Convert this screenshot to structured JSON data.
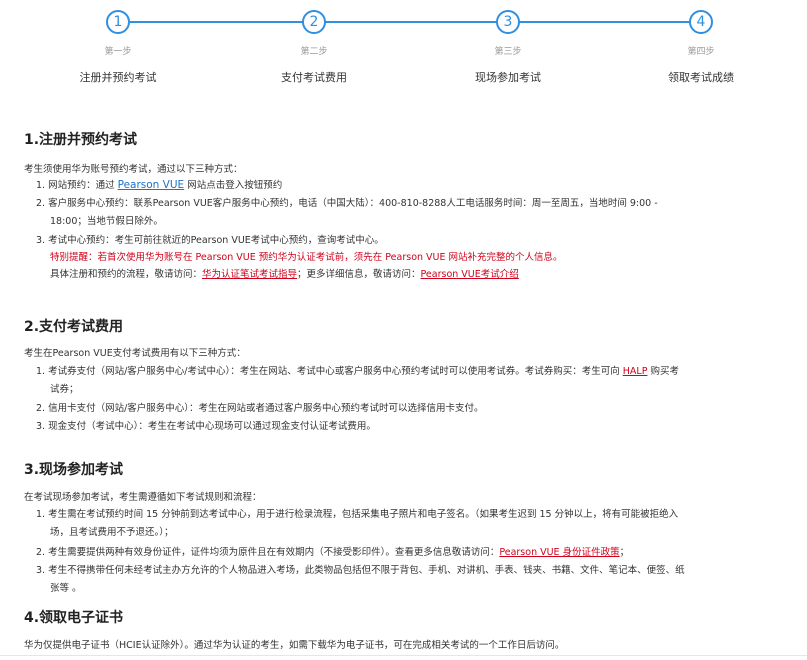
{
  "stepper": {
    "steps": [
      {
        "number": "1",
        "title": "第一步",
        "label": "注册并预约考试"
      },
      {
        "number": "2",
        "title": "第二步",
        "label": "支付考试费用"
      },
      {
        "number": "3",
        "title": "第三步",
        "label": "现场参加考试"
      },
      {
        "number": "4",
        "title": "第四步",
        "label": "领取考试成绩"
      }
    ]
  },
  "section1": {
    "title": "1.注册并预约考试",
    "intro": "考生须使用华为账号预约考试，通过以下三种方式：",
    "item1_prefix": "1. 网站预约：通过 ",
    "item1_link": "Pearson VUE",
    "item1_suffix": " 网站点击登入按钮预约",
    "item2_line1": "2. 客户服务中心预约：联系Pearson VUE客户服务中心预约，电话（中国大陆）：400-810-8288人工电话服务时间：周一至周五，当地时间 9:00 -",
    "item2_line2": "18:00；当地节假日除外。",
    "item3": "3. 考试中心预约：考生可前往就近的Pearson VUE考试中心预约，查询考试中心。",
    "notice": "特别提醒：若首次使用华为账号在 Pearson VUE 预约华为认证考试前，须先在 Pearson VUE 网站补充完整的个人信息。",
    "detail_prefix": "具体注册和预约的流程，敬请访问：",
    "detail_link1": "华为认证笔试考试指导",
    "detail_middle": "；更多详细信息，敬请访问：",
    "detail_link2": "Pearson VUE考试介绍"
  },
  "section2": {
    "title": "2.支付考试费用",
    "intro": "考生在Pearson VUE支付考试费用有以下三种方式：",
    "item1_line1_prefix": "1. 考试券支付（网站/客户服务中心/考试中心）：考生在网站、考试中心或客户服务中心预约考试时可以使用考试券。考试券购买：考生可向 ",
    "item1_link": "HALP",
    "item1_line1_suffix": " 购买考",
    "item1_line2": "试券；",
    "item2": "2. 信用卡支付（网站/客户服务中心）：考生在网站或者通过客户服务中心预约考试时可以选择信用卡支付。",
    "item3": "3. 现金支付（考试中心）：考生在考试中心现场可以通过现金支付认证考试费用。"
  },
  "section3": {
    "title": "3.现场参加考试",
    "intro": "在考试现场参加考试，考生需遵循如下考试规则和流程：",
    "item1_line1": "1. 考生需在考试预约时间 15 分钟前到达考试中心，用于进行检录流程，包括采集电子照片和电子签名。（如果考生迟到 15 分钟以上，将有可能被拒绝入",
    "item1_line2": "场，且考试费用不予退还。）；",
    "item2_prefix": "2. 考生需要提供两种有效身份证件，证件均须为原件且在有效期内（不接受影印件）。查看更多信息敬请访问：",
    "item2_link": "Pearson VUE 身份证件政策",
    "item2_suffix": "；",
    "item3_line1": "3. 考生不得携带任何未经考试主办方允许的个人物品进入考场，此类物品包括但不限于背包、手机、对讲机、手表、钱夹、书籍、文件、笔记本、便签、纸",
    "item3_line2": "张等 。"
  },
  "section4": {
    "title": "4.领取电子证书",
    "intro": "华为仅提供电子证书（HCIE认证除外）。通过华为认证的考生，如需下载华为电子证书，可在完成相关考试的一个工作日后访问。"
  },
  "colors": {
    "accent": "#2f8fe0",
    "link": "#1a73c9",
    "warning": "#d0021b"
  }
}
